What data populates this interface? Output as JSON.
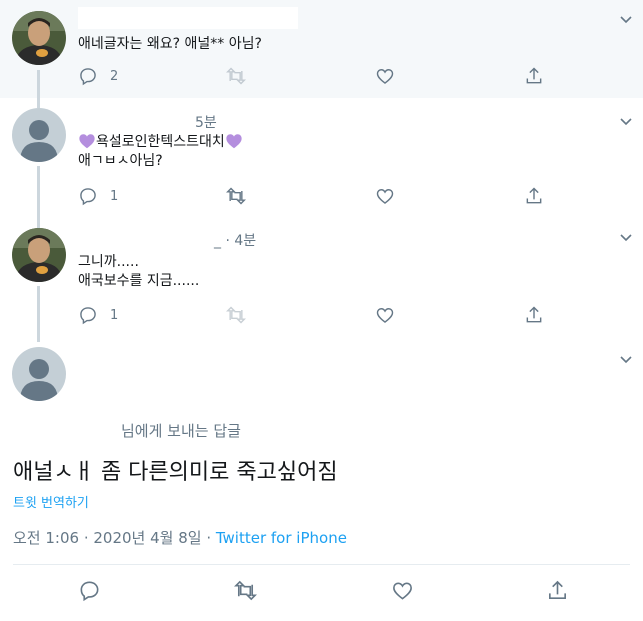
{
  "tweets": [
    {
      "meta": "",
      "lines": [
        "애네글자는 왜요? 애널** 아님?"
      ],
      "reply_count": "2",
      "avatar": "photo"
    },
    {
      "meta": "5분",
      "lines": [
        "욕설로인한텍스트대치",
        "애ㄱㅂㅅ아님?"
      ],
      "reply_count": "1",
      "avatar": "default"
    },
    {
      "meta": "_ · 4분",
      "lines": [
        "그니까.....",
        "애국보수를 지금......"
      ],
      "reply_count": "1",
      "avatar": "photo"
    }
  ],
  "main_tweet": {
    "reply_to": "님에게 보내는 답글",
    "text": "애널ㅅㅐ 좀 다른의미로 죽고싶어짐",
    "translate_label": "트윗 번역하기",
    "timestamp": "오전 1:06 · 2020년 4월 8일 · ",
    "source": "Twitter for iPhone"
  },
  "colors": {
    "accent": "#1da1f2",
    "muted": "#657786",
    "heart_emoji": "#b48ede",
    "highlight_bg": "#f5f8fa"
  },
  "icons": [
    "reply-icon",
    "retweet-icon",
    "like-icon",
    "share-icon",
    "chevron-down-icon",
    "purple-heart-icon"
  ]
}
